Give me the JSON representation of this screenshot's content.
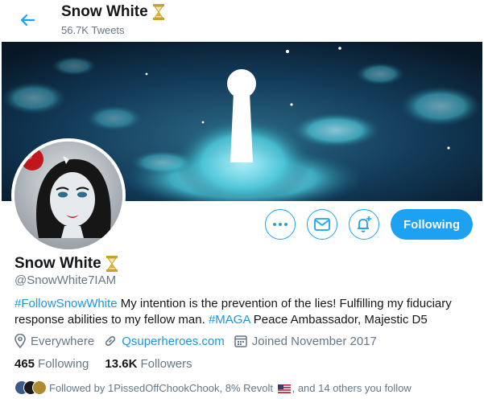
{
  "header": {
    "title": "Snow White",
    "title_emoji": "hourglass-icon",
    "tweets_count": "56.7K Tweets"
  },
  "actions": {
    "more_icon": "more-icon",
    "message_icon": "envelope-icon",
    "notify_icon": "bell-plus-icon",
    "follow_label": "Following"
  },
  "profile": {
    "name": "Snow White",
    "handle": "@SnowWhite7IAM",
    "bio_hashtag1": "#FollowSnowWhite",
    "bio_text1": " My intention is the prevention of the lies! Fulfilling my fiduciary response abilities to my fellow man. ",
    "bio_hashtag2": "#MAGA",
    "bio_text2": " Peace Ambassador, Majestic D5",
    "location": "Everywhere",
    "website": "Qsuperheroes.com",
    "joined": "Joined November 2017"
  },
  "counts": {
    "following_num": "465",
    "following_label": "Following",
    "followers_num": "13.6K",
    "followers_label": "Followers"
  },
  "followed_by": {
    "prefix": "Followed by 1PissedOffChookChook, 8% Revolt",
    "suffix": ", and 14 others you follow"
  },
  "colors": {
    "accent": "#1da1f2",
    "link": "#1b95e0",
    "secondary_text": "#657786"
  }
}
